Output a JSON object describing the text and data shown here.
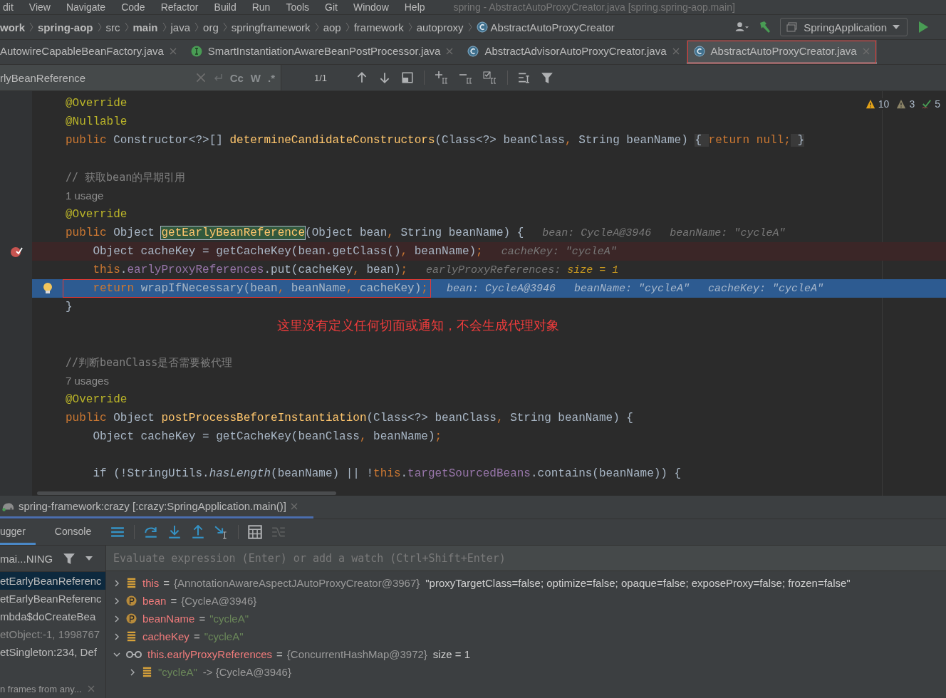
{
  "menu": [
    "dit",
    "View",
    "Navigate",
    "Code",
    "Refactor",
    "Build",
    "Run",
    "Tools",
    "Git",
    "Window",
    "Help"
  ],
  "window_title": "spring - AbstractAutoProxyCreator.java [spring.spring-aop.main]",
  "breadcrumbs": [
    {
      "label": "work",
      "bold": true,
      "kind": "folder"
    },
    {
      "label": "spring-aop",
      "bold": true,
      "kind": "folder"
    },
    {
      "label": "src",
      "bold": false,
      "kind": "folder"
    },
    {
      "label": "main",
      "bold": true,
      "kind": "folder"
    },
    {
      "label": "java",
      "bold": false,
      "kind": "folder"
    },
    {
      "label": "org",
      "bold": false,
      "kind": "folder"
    },
    {
      "label": "springframework",
      "bold": false,
      "kind": "folder"
    },
    {
      "label": "aop",
      "bold": false,
      "kind": "folder"
    },
    {
      "label": "framework",
      "bold": false,
      "kind": "folder"
    },
    {
      "label": "autoproxy",
      "bold": false,
      "kind": "folder"
    },
    {
      "label": "AbstractAutoProxyCreator",
      "bold": false,
      "kind": "class"
    }
  ],
  "run_config": "SpringApplication",
  "tabs": [
    {
      "label": "AutowireCapableBeanFactory.java",
      "kind": "none",
      "selected": false
    },
    {
      "label": "SmartInstantiationAwareBeanPostProcessor.java",
      "kind": "interface",
      "selected": false
    },
    {
      "label": "AbstractAdvisorAutoProxyCreator.java",
      "kind": "class",
      "selected": false
    },
    {
      "label": "AbstractAutoProxyCreator.java",
      "kind": "class",
      "selected": true,
      "outlined": true
    }
  ],
  "find": {
    "value": "rlyBeanReference",
    "toggles": [
      "Cc",
      "W",
      ".*"
    ],
    "count": "1/1"
  },
  "inspections": {
    "warnings": "10",
    "weak_warnings": "3",
    "typos": "5"
  },
  "code": [
    {
      "kind": "plain",
      "tokens": [
        {
          "kind": "ann",
          "text": "@Override"
        }
      ]
    },
    {
      "kind": "plain",
      "tokens": [
        {
          "kind": "ann",
          "text": "@Nullable"
        }
      ]
    },
    {
      "kind": "plain",
      "tokens": [
        {
          "kind": "kw",
          "text": "public "
        },
        {
          "kind": "plain",
          "text": "Constructor<?>[] "
        },
        {
          "kind": "fn",
          "text": "determineCandidateConstructors"
        },
        {
          "kind": "plain",
          "text": "(Class<?> beanClass"
        },
        {
          "kind": "kw",
          "text": ", "
        },
        {
          "kind": "plain",
          "text": "String beanName) "
        },
        {
          "kind": "fold",
          "text": "{ "
        },
        {
          "kind": "kw",
          "text": "return null;"
        },
        {
          "kind": "fold",
          "text": " }"
        }
      ]
    },
    {
      "kind": "plain"
    },
    {
      "kind": "plain",
      "tokens": [
        {
          "kind": "cmt",
          "text": "// 获取bean的早期引用"
        }
      ]
    },
    {
      "kind": "plain",
      "tokens": [
        {
          "kind": "usage",
          "text": "1 usage"
        }
      ]
    },
    {
      "kind": "plain",
      "tokens": [
        {
          "kind": "ann",
          "text": "@Override"
        }
      ]
    },
    {
      "kind": "plain",
      "tokens": [
        {
          "kind": "kw",
          "text": "public "
        },
        {
          "kind": "plain",
          "text": "Object "
        },
        {
          "kind": "match",
          "text": "getEarlyBeanReference"
        },
        {
          "kind": "plain",
          "text": "(Object bean"
        },
        {
          "kind": "kw",
          "text": ", "
        },
        {
          "kind": "plain",
          "text": "String beanName) {"
        },
        {
          "kind": "hint",
          "text": "bean: CycleA@3946"
        },
        {
          "kind": "hint",
          "text": "beanName: \"cycleA\""
        }
      ]
    },
    {
      "kind": "breakpoint",
      "tokens": [
        {
          "kind": "plain",
          "text": "    Object cacheKey = getCacheKey(bean.getClass()"
        },
        {
          "kind": "kw",
          "text": ", "
        },
        {
          "kind": "plain",
          "text": "beanName)"
        },
        {
          "kind": "kw",
          "text": ";"
        },
        {
          "kind": "hint",
          "text": "cacheKey: \"cycleA\""
        }
      ]
    },
    {
      "kind": "plain",
      "tokens": [
        {
          "kind": "kw",
          "text": "    this"
        },
        {
          "kind": "plain",
          "text": "."
        },
        {
          "kind": "field",
          "text": "earlyProxyReferences"
        },
        {
          "kind": "plain",
          "text": ".put(cacheKey"
        },
        {
          "kind": "kw",
          "text": ", "
        },
        {
          "kind": "plain",
          "text": "bean)"
        },
        {
          "kind": "kw",
          "text": ";"
        },
        {
          "kind": "hint",
          "text": "earlyProxyReferences: "
        },
        {
          "kind": "hintval",
          "text": "size = 1"
        }
      ]
    },
    {
      "kind": "current",
      "boxed": true,
      "tokens": [
        {
          "kind": "kw",
          "text": "    return "
        },
        {
          "kind": "plain",
          "text": "wrapIfNecessary(bean"
        },
        {
          "kind": "kw",
          "text": ", "
        },
        {
          "kind": "plain",
          "text": "beanName"
        },
        {
          "kind": "kw",
          "text": ", "
        },
        {
          "kind": "plain",
          "text": "cacheKey)"
        },
        {
          "kind": "kw",
          "text": ";"
        },
        {
          "kind": "hint",
          "text": "bean: CycleA@3946"
        },
        {
          "kind": "hint",
          "text": "beanName: \"cycleA\""
        },
        {
          "kind": "hint",
          "text": "cacheKey: \"cycleA\""
        }
      ]
    },
    {
      "kind": "plain",
      "tokens": [
        {
          "kind": "plain",
          "text": "}"
        }
      ]
    },
    {
      "kind": "note",
      "tokens": [
        {
          "kind": "note",
          "text": "这里没有定义任何切面或通知，不会生成代理对象"
        }
      ]
    },
    {
      "kind": "plain"
    },
    {
      "kind": "plain",
      "tokens": [
        {
          "kind": "cmt",
          "text": "//判断beanClass是否需要被代理"
        }
      ]
    },
    {
      "kind": "plain",
      "tokens": [
        {
          "kind": "usage",
          "text": "7 usages"
        }
      ]
    },
    {
      "kind": "plain",
      "tokens": [
        {
          "kind": "ann",
          "text": "@Override"
        }
      ]
    },
    {
      "kind": "plain",
      "tokens": [
        {
          "kind": "kw",
          "text": "public "
        },
        {
          "kind": "plain",
          "text": "Object "
        },
        {
          "kind": "fn",
          "text": "postProcessBeforeInstantiation"
        },
        {
          "kind": "plain",
          "text": "(Class<?> beanClass"
        },
        {
          "kind": "kw",
          "text": ", "
        },
        {
          "kind": "plain",
          "text": "String beanName) {"
        }
      ]
    },
    {
      "kind": "plain",
      "tokens": [
        {
          "kind": "plain",
          "text": "    Object cacheKey = getCacheKey(beanClass"
        },
        {
          "kind": "kw",
          "text": ", "
        },
        {
          "kind": "plain",
          "text": "beanName)"
        },
        {
          "kind": "kw",
          "text": ";"
        }
      ]
    },
    {
      "kind": "plain"
    },
    {
      "kind": "plain",
      "tokens": [
        {
          "kind": "plain",
          "text": "    if (!StringUtils."
        },
        {
          "kind": "static",
          "text": "hasLength"
        },
        {
          "kind": "plain",
          "text": "(beanName) || !"
        },
        {
          "kind": "kw",
          "text": "this"
        },
        {
          "kind": "plain",
          "text": "."
        },
        {
          "kind": "field",
          "text": "targetSourcedBeans"
        },
        {
          "kind": "plain",
          "text": ".contains(beanName)) {"
        }
      ]
    }
  ],
  "debug": {
    "session": "spring-framework:crazy [:crazy:SpringApplication.main()]",
    "tabs": [
      {
        "label": "ugger",
        "selected": true
      },
      {
        "label": "Console",
        "selected": false
      }
    ],
    "thread": "mai...NING",
    "frames": [
      {
        "label": "etEarlyBeanReferenc",
        "selected": true,
        "dim": false
      },
      {
        "label": "etEarlyBeanReferenc",
        "selected": false,
        "dim": false
      },
      {
        "label": "mbda$doCreateBea",
        "selected": false,
        "dim": false
      },
      {
        "label": "etObject:-1, 1998767",
        "selected": false,
        "dim": true
      },
      {
        "label": "etSingleton:234, Def",
        "selected": false,
        "dim": false
      }
    ],
    "frames_footer": "n frames from any...",
    "eval_placeholder": "Evaluate expression (Enter) or add a watch (Ctrl+Shift+Enter)",
    "variables": [
      {
        "kind": "field",
        "name": "this",
        "sep": "=",
        "value": "{AnnotationAwareAspectJAutoProxyCreator@3967}",
        "is_string": false,
        "extra": "\"proxyTargetClass=false; optimize=false; opaque=false; exposeProxy=false; frozen=false\"",
        "expanded": false
      },
      {
        "kind": "param",
        "name": "bean",
        "sep": "=",
        "value": "{CycleA@3946}",
        "is_string": false,
        "expanded": false
      },
      {
        "kind": "param",
        "name": "beanName",
        "sep": "=",
        "value": "\"cycleA\"",
        "is_string": true,
        "expanded": false
      },
      {
        "kind": "field",
        "name": "cacheKey",
        "sep": "=",
        "value": "\"cycleA\"",
        "is_string": true,
        "expanded": false
      },
      {
        "kind": "watch",
        "name": "this.earlyProxyReferences",
        "sep": "=",
        "value": "{ConcurrentHashMap@3972}",
        "is_string": false,
        "extra": "size = 1",
        "expanded": true,
        "children": [
          {
            "kind": "field",
            "key": "\"cycleA\"",
            "value": "-> {CycleA@3946}",
            "expanded": false
          }
        ]
      }
    ]
  }
}
